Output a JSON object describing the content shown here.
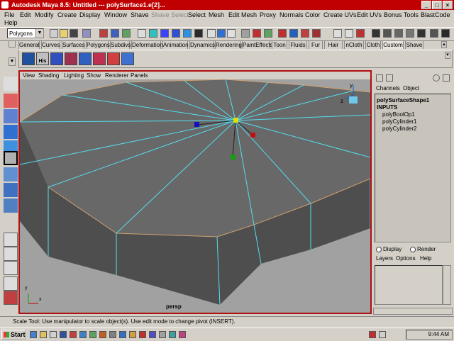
{
  "window": {
    "title": "Autodesk Maya 8.5: Untitled   ---   polySurface1.e[2]..."
  },
  "menubar": {
    "row1": [
      "File",
      "Edit",
      "Modify",
      "Create",
      "Display",
      "Window",
      "Shave",
      "Shave Select",
      "Select",
      "Mesh",
      "Edit Mesh",
      "Proxy",
      "Normals",
      "Color",
      "Create UVs",
      "Edit UVs",
      "Bonus Tools",
      "BlastCode"
    ],
    "row2": [
      "Help"
    ]
  },
  "statusline": {
    "mode_value": "Polygons"
  },
  "shelf_tabs": [
    "General",
    "Curves",
    "Surfaces",
    "Polygons",
    "Subdivs",
    "Deformation",
    "Animation",
    "Dynamics",
    "Rendering",
    "PaintEffects",
    "Toon",
    "Fluids",
    "Fur",
    "Hair",
    "nCloth",
    "Cloth",
    "Custom",
    "Shave"
  ],
  "shelf_active_tab": "Custom",
  "shelf_icon_label": "His",
  "panel_menu": [
    "View",
    "Shading",
    "Lighting",
    "Show",
    "Renderer",
    "Panels"
  ],
  "viewport": {
    "camera": "persp",
    "axis_labels": {
      "x": "x",
      "y": "y",
      "z": "z"
    }
  },
  "channel_box": {
    "tabs": [
      "Channels",
      "Object"
    ],
    "object_name": "polySurfaceShape1",
    "inputs_label": "INPUTS",
    "inputs": [
      "polyBoolOp1",
      "polyCylinder1",
      "polyCylinder2"
    ]
  },
  "layer_editor": {
    "display_label": "Display",
    "render_label": "Render",
    "menu": [
      "Layers",
      "Options",
      "Help"
    ]
  },
  "help_line": "Scale Tool: Use manipulator to scale object(s). Use edit mode to change pivot (INSERT).",
  "taskbar": {
    "start_label": "Start",
    "clock": "9:44 AM"
  },
  "colors": {
    "title_bar": "#c00000",
    "viewport_bg": "#a1a1a1",
    "mesh_top": "#686868",
    "wire": "#55ddee",
    "active_border": "#b01010"
  }
}
